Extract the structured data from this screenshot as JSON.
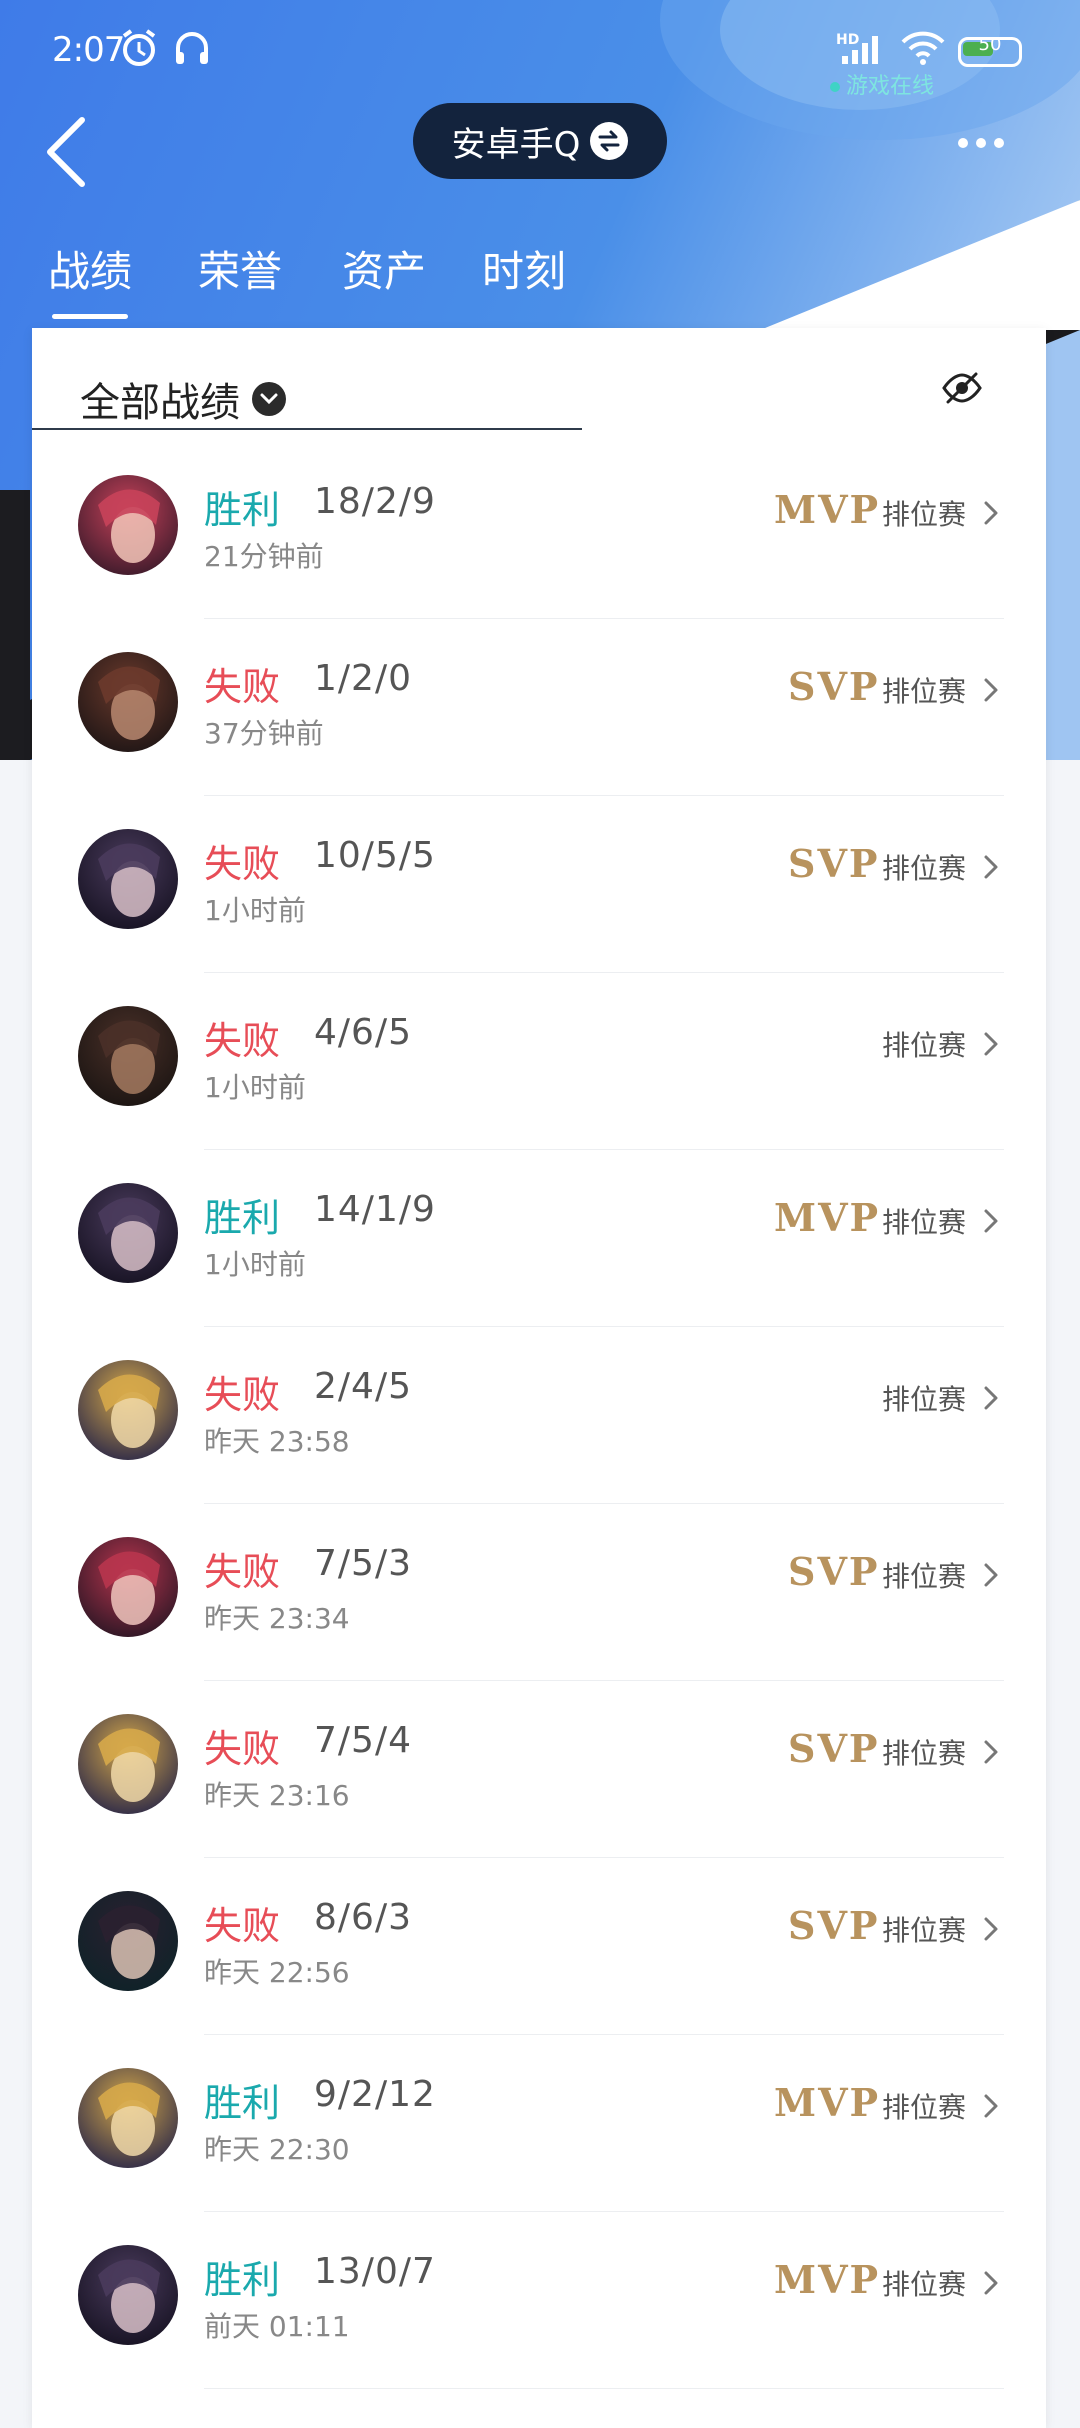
{
  "status_bar": {
    "time": "2:07",
    "network_label": "HD",
    "battery_level": "50",
    "game_status": "游戏在线"
  },
  "header": {
    "account_name": "安卓手Q"
  },
  "tabs": [
    {
      "label": "战绩",
      "active": true
    },
    {
      "label": "荣誉",
      "active": false
    },
    {
      "label": "资产",
      "active": false
    },
    {
      "label": "时刻",
      "active": false
    }
  ],
  "filter": {
    "label": "全部战绩"
  },
  "matches": [
    {
      "result": "胜利",
      "outcome": "win",
      "kda": "18/2/9",
      "time": "21分钟前",
      "badge": "MVP",
      "mode": "排位赛"
    },
    {
      "result": "失败",
      "outcome": "lose",
      "kda": "1/2/0",
      "time": "37分钟前",
      "badge": "SVP",
      "mode": "排位赛"
    },
    {
      "result": "失败",
      "outcome": "lose",
      "kda": "10/5/5",
      "time": "1小时前",
      "badge": "SVP",
      "mode": "排位赛"
    },
    {
      "result": "失败",
      "outcome": "lose",
      "kda": "4/6/5",
      "time": "1小时前",
      "badge": "",
      "mode": "排位赛"
    },
    {
      "result": "胜利",
      "outcome": "win",
      "kda": "14/1/9",
      "time": "1小时前",
      "badge": "MVP",
      "mode": "排位赛"
    },
    {
      "result": "失败",
      "outcome": "lose",
      "kda": "2/4/5",
      "time": "昨天 23:58",
      "badge": "",
      "mode": "排位赛"
    },
    {
      "result": "失败",
      "outcome": "lose",
      "kda": "7/5/3",
      "time": "昨天 23:34",
      "badge": "SVP",
      "mode": "排位赛"
    },
    {
      "result": "失败",
      "outcome": "lose",
      "kda": "7/5/4",
      "time": "昨天 23:16",
      "badge": "SVP",
      "mode": "排位赛"
    },
    {
      "result": "失败",
      "outcome": "lose",
      "kda": "8/6/3",
      "time": "昨天 22:56",
      "badge": "SVP",
      "mode": "排位赛"
    },
    {
      "result": "胜利",
      "outcome": "win",
      "kda": "9/2/12",
      "time": "昨天 22:30",
      "badge": "MVP",
      "mode": "排位赛"
    },
    {
      "result": "胜利",
      "outcome": "win",
      "kda": "13/0/7",
      "time": "前天 01:11",
      "badge": "MVP",
      "mode": "排位赛"
    }
  ],
  "colors": {
    "win": "#1aa9ad",
    "lose": "#e74d57",
    "badge_gold": "#b8935e"
  }
}
